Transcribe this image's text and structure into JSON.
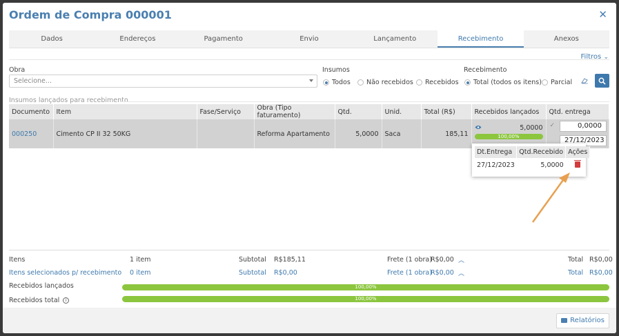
{
  "modal": {
    "title": "Ordem de Compra 000001",
    "close_label": "✕"
  },
  "tabs": [
    {
      "label": "Dados"
    },
    {
      "label": "Endereços"
    },
    {
      "label": "Pagamento"
    },
    {
      "label": "Envio"
    },
    {
      "label": "Lançamento"
    },
    {
      "label": "Recebimento",
      "active": true
    },
    {
      "label": "Anexos"
    }
  ],
  "filters": {
    "toggle_label": "Filtros",
    "obra_label": "Obra",
    "obra_placeholder": "Selecione...",
    "insumos_label": "Insumos",
    "insumos_options": [
      "Todos",
      "Não recebidos",
      "Recebidos"
    ],
    "insumos_selected": "Todos",
    "recebimento_label": "Recebimento",
    "recebimento_options": [
      "Total (todos os itens)",
      "Parcial"
    ],
    "recebimento_selected": "Total (todos os itens)"
  },
  "grid": {
    "section_title": "Insumos lançados para recebimento",
    "columns": [
      "Documento",
      "Item",
      "Fase/Serviço",
      "Obra (Tipo faturamento)",
      "Qtd.",
      "Unid.",
      "Total (R$)",
      "Recebidos lançados",
      "Qtd. entrega"
    ],
    "rows": [
      {
        "documento": "000250",
        "item": "Cimento CP II 32 50KG",
        "fase": "",
        "obra": "Reforma Apartamento",
        "qtd": "5,0000",
        "unid": "Saca",
        "total": "185,11",
        "recebidos": "5,0000",
        "recebidos_pct": "100,00%",
        "recebidos_fraction": 1.0,
        "qtd_entrega": "0,0000",
        "data_entrega": "27/12/2023"
      }
    ]
  },
  "popup": {
    "columns": [
      "Dt.Entrega",
      "Qtd.Recebido",
      "Ações"
    ],
    "rows": [
      {
        "data": "27/12/2023",
        "qtd": "5,0000"
      }
    ]
  },
  "footer": {
    "itens_label": "Itens",
    "itens_value": "1 item",
    "subtotal_label": "Subtotal",
    "subtotal_value": "R$185,11",
    "frete_label": "Frete (1 obra)",
    "frete_value": "R$0,00",
    "total_label": "Total",
    "total_value": "R$0,00",
    "sel_label": "Itens selecionados p/ recebimento",
    "sel_value": "0 item",
    "sel_subtotal_label": "Subtotal",
    "sel_subtotal_value": "R$0,00",
    "sel_frete_label": "Frete (1 obra)",
    "sel_frete_value": "R$0,00",
    "sel_total_label": "Total",
    "sel_total_value": "R$0,00",
    "recebidos_lancados_label": "Recebidos lançados",
    "recebidos_lancados_pct": "100,00%",
    "recebidos_total_label": "Recebidos total",
    "recebidos_total_pct": "100,00%",
    "info_icon": "i"
  },
  "actions": {
    "relatorios_label": "Relatórios"
  },
  "colors": {
    "accent": "#3e79ad",
    "progress": "#8cc63f",
    "delete": "#d23c3c",
    "annotation_arrow": "#e8a050"
  }
}
